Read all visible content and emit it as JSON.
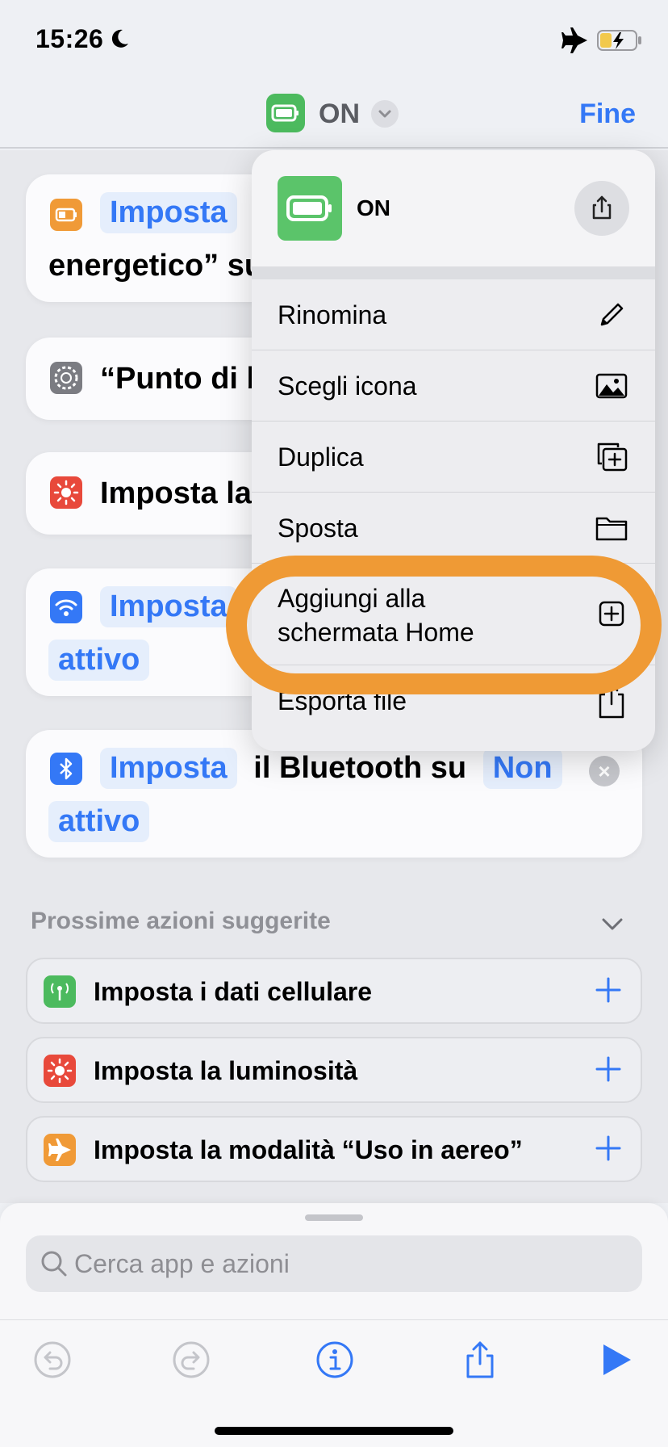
{
  "status": {
    "time": "15:26"
  },
  "nav": {
    "title": "ON",
    "done": "Fine"
  },
  "cards": [
    {
      "pill": "Imposta",
      "line2": "energetico” su"
    },
    {
      "text": "“Punto di b"
    },
    {
      "text": "Imposta la"
    },
    {
      "pill": "Imposta",
      "pill2": "attivo"
    },
    {
      "pill": "Imposta",
      "text": "il Bluetooth su",
      "pill_value": "Non",
      "pill2": "attivo"
    }
  ],
  "suggestions": {
    "title": "Prossime azioni suggerite",
    "items": [
      {
        "label": "Imposta i dati cellulare",
        "color": "#4cba5e"
      },
      {
        "label": "Imposta la luminosità",
        "color": "#e8493b"
      },
      {
        "label": "Imposta la modalità “Uso in aereo”",
        "color": "#f09a37"
      }
    ]
  },
  "search": {
    "placeholder": "Cerca app e azioni"
  },
  "menu": {
    "app_name": "ON",
    "items": [
      {
        "label": "Rinomina",
        "icon": "pencil-icon"
      },
      {
        "label": "Scegli icona",
        "icon": "photo-icon"
      },
      {
        "label": "Duplica",
        "icon": "duplicate-icon"
      },
      {
        "label": "Sposta",
        "icon": "folder-icon"
      },
      {
        "label_line1": "Aggiungi alla",
        "label_line2": "schermata Home",
        "icon": "plus-square-icon"
      },
      {
        "label": "Esporta file",
        "icon": "share-icon"
      }
    ]
  },
  "colors": {
    "accent": "#3478f6",
    "highlight": "#ef9a35",
    "battery_green": "#4cba5e"
  }
}
